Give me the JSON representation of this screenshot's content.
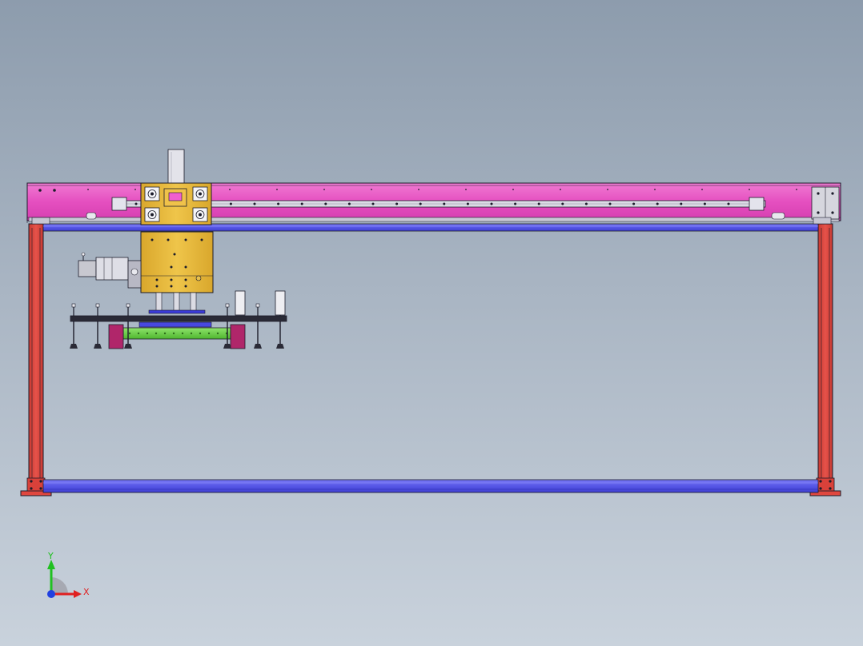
{
  "colors": {
    "beam": "#e54fc0",
    "beam_light": "#f28ad8",
    "column": "#e0473f",
    "base_beam": "#5b5bea",
    "carriage": "#e8b93a",
    "green_bar": "#6cd24a",
    "magenta_block": "#b0266a",
    "rail": "#d9d9e2",
    "outline": "#1c1c2a",
    "axis_x": "#e02020",
    "axis_y": "#20c020",
    "axis_z": "#2040e0"
  },
  "triad": {
    "x_label": "X",
    "y_label": "Y"
  },
  "icons": {
    "triad": "coordinate-triad-icon"
  }
}
